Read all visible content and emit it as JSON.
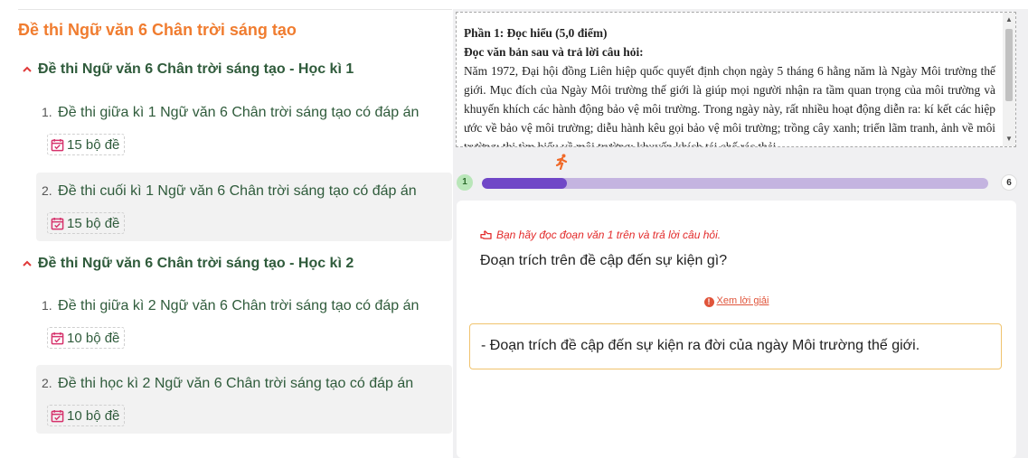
{
  "left_panel": {
    "title": "Đề thi Ngữ văn 6 Chân trời sáng tạo",
    "sections": [
      {
        "heading": "Đề thi Ngữ văn 6 Chân trời sáng tạo - Học kì 1",
        "items": [
          {
            "number": "1.",
            "label": "Đề thi giữa kì 1 Ngữ văn 6 Chân trời sáng tạo có đáp án",
            "badge": "15 bộ đề"
          },
          {
            "number": "2.",
            "label": "Đề thi cuối kì 1 Ngữ văn 6 Chân trời sáng tạo có đáp án",
            "badge": "15 bộ đề"
          }
        ]
      },
      {
        "heading": "Đề thi Ngữ văn 6 Chân trời sáng tạo - Học kì 2",
        "items": [
          {
            "number": "1.",
            "label": "Đề thi giữa kì 2 Ngữ văn 6 Chân trời sáng tạo có đáp án",
            "badge": "10 bộ đề"
          },
          {
            "number": "2.",
            "label": "Đề thi học kì 2 Ngữ văn 6 Chân trời sáng tạo có đáp án",
            "badge": "10 bộ đề"
          }
        ]
      }
    ]
  },
  "reading": {
    "part_heading": "Phần 1: Đọc hiểu (5,0 điểm)",
    "instruction": "Đọc văn bản sau và trả lời câu hỏi:",
    "passage": "Năm 1972, Đại hội đồng Liên hiệp quốc quyết định chọn ngày 5 tháng 6 hằng năm là Ngày Môi trường thế giới. Mục đích của Ngày Môi trường thế giới là giúp mọi người nhận ra tầm quan trọng của môi trường và khuyến khích các hành động bảo vệ môi trường. Trong ngày này, rất nhiều hoạt động diễn ra: kí kết các hiệp ước về bảo vệ môi trường; diễu hành kêu gọi bảo vệ môi trường; trồng cây xanh; triển lãm tranh, ảnh về môi trường; thi tìm hiểu về môi trường; khuyến khích tái chế rác thải..."
  },
  "progress": {
    "current": "1",
    "total": "6",
    "fraction": 0.167
  },
  "question_card": {
    "hint": "Bạn hãy đọc đoạn văn 1 trên và trả lời câu hỏi.",
    "question": "Đoạn trích trên đề cập đến sự kiện gì?",
    "solution_link": "Xem lời giải",
    "answer": "- Đoạn trích đề cập đến sự kiện ra đời của ngày Môi trường thế giới."
  },
  "colors": {
    "title_orange": "#f07c2f",
    "heading_green": "#2f5b3b",
    "progress_fill": "#7047c7",
    "progress_track": "#c4b4e0",
    "hint_red": "#e32b2b",
    "answer_border": "#f0c36d",
    "badge_icon": "#d6336c"
  },
  "icons": [
    "chevron-up-icon",
    "calendar-check-icon",
    "runner-icon",
    "hand-pointing-icon",
    "info-icon"
  ]
}
